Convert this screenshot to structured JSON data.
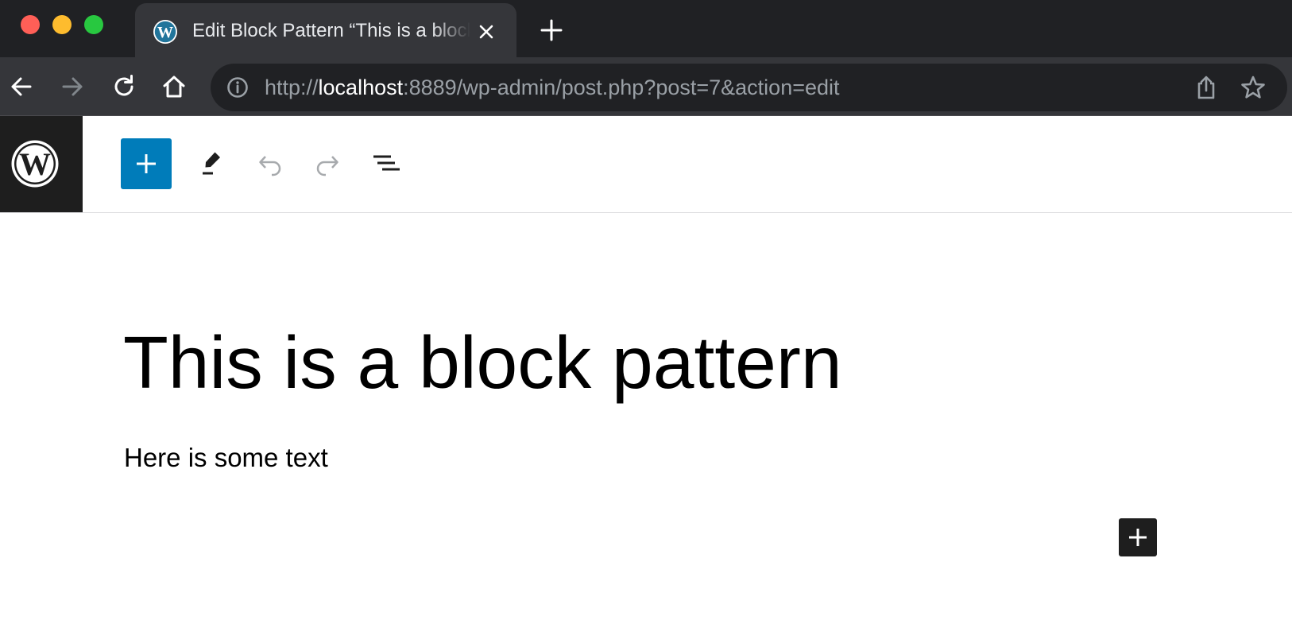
{
  "browser": {
    "window_controls": {
      "close": "close-window",
      "minimize": "minimize-window",
      "maximize": "maximize-window"
    },
    "tab": {
      "title": "Edit Block Pattern “This is a block pattern” ‹ WordPress",
      "favicon": "wordpress-icon",
      "close_icon": "close-icon"
    },
    "new_tab_icon": "plus-icon",
    "nav": {
      "back_icon": "arrow-left-icon",
      "forward_icon": "arrow-right-icon",
      "reload_icon": "reload-icon",
      "home_icon": "home-icon"
    },
    "address_bar": {
      "scheme": "http://",
      "host": "localhost",
      "rest": ":8889/wp-admin/post.php?post=7&action=edit",
      "info_icon": "info-icon",
      "share_icon": "share-icon",
      "bookmark_icon": "star-icon"
    },
    "colors": {
      "tabstrip": "#202124",
      "toolbar": "#35363a",
      "omnibox": "#202124"
    }
  },
  "editor": {
    "logo_icon": "wordpress-logo-icon",
    "toolbar": {
      "inserter_icon": "plus-icon",
      "tools_icon": "pencil-icon",
      "undo_icon": "undo-icon",
      "redo_icon": "redo-icon",
      "list_view_icon": "list-view-icon"
    },
    "content": {
      "title": "This is a block pattern",
      "paragraph": "Here is some text"
    },
    "block_appender_icon": "plus-icon",
    "colors": {
      "accent": "#007cba",
      "dark": "#1e1e1e"
    }
  }
}
